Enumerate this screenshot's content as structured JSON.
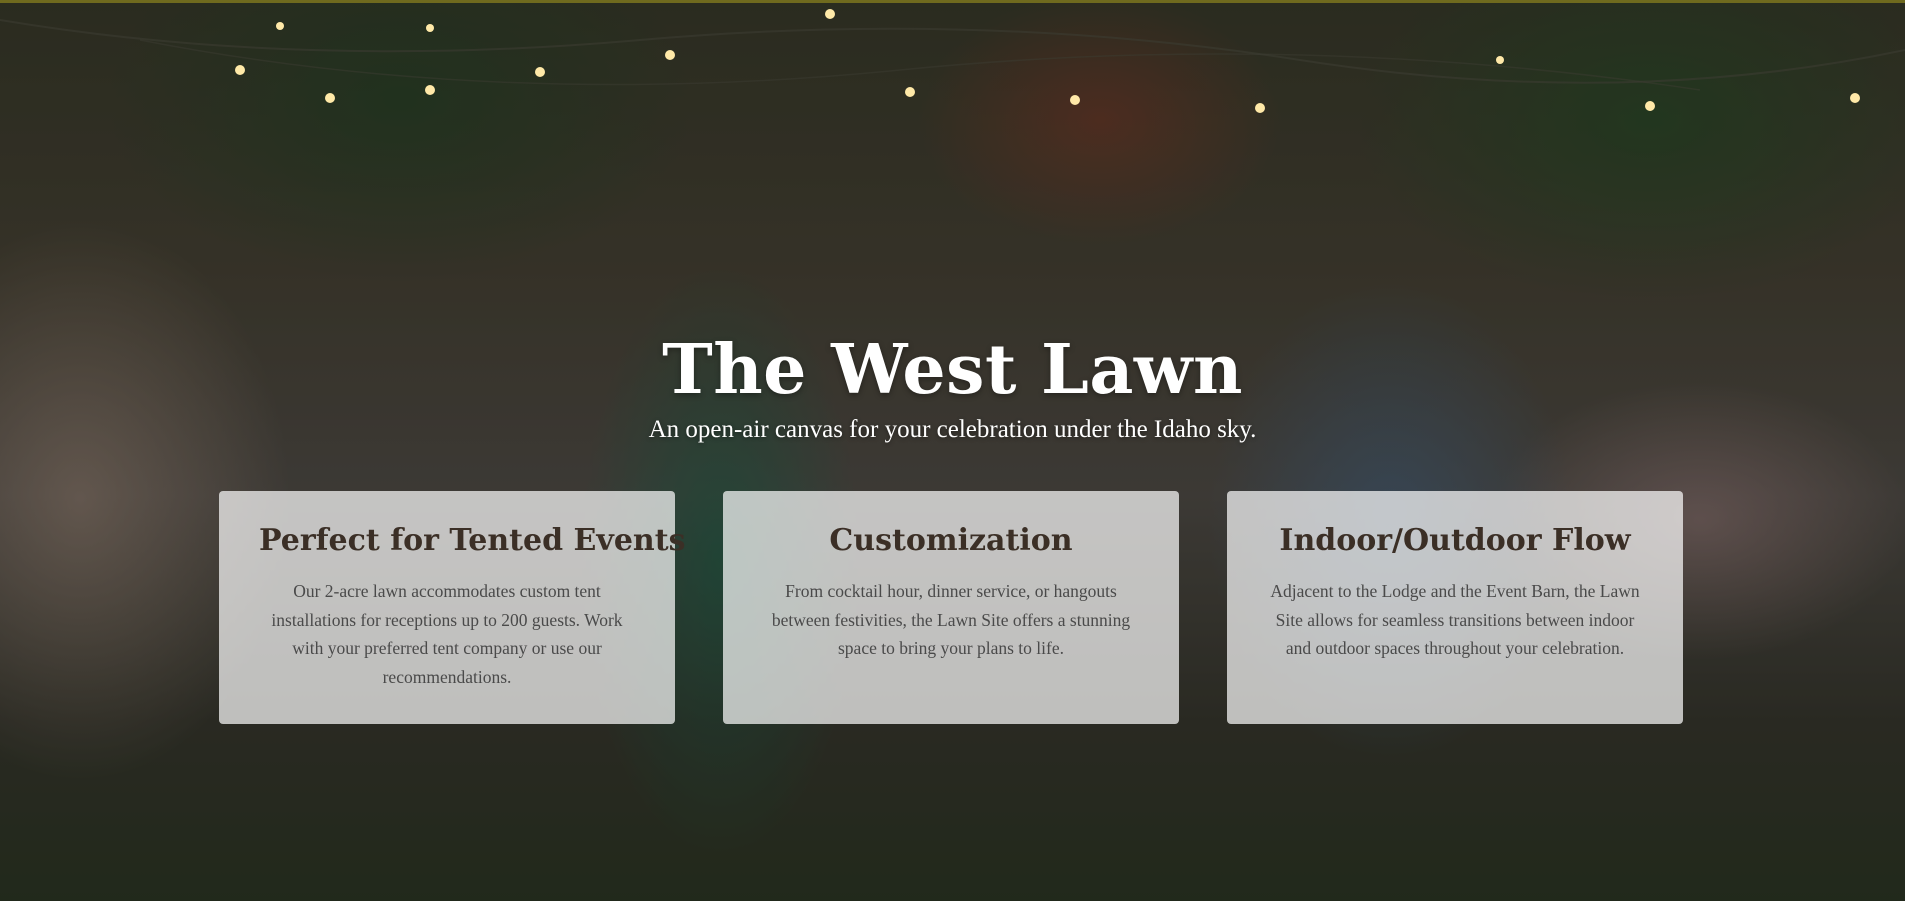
{
  "hero": {
    "title": "The West Lawn",
    "subtitle": "An open-air canvas for your celebration under the Idaho sky."
  },
  "features": [
    {
      "title": "Perfect for Tented Events",
      "text": "Our 2-acre lawn accommodates custom tent installations for receptions up to 200 guests. Work with your preferred tent company or use our recommendations."
    },
    {
      "title": "Customization",
      "text": "From cocktail hour, dinner service, or hangouts between festivities, the Lawn Site offers a stunning space to bring your plans to life."
    },
    {
      "title": "Indoor/Outdoor Flow",
      "text": "Adjacent to the Lodge and the Event Barn, the Lawn Site allows for seamless transitions between indoor and outdoor spaces throughout your celebration."
    }
  ],
  "colors": {
    "card_background": "#ffffff",
    "card_title": "#3b2f26",
    "card_text": "#4a4a4a",
    "hero_text": "#ffffff",
    "top_accent_line": "#6f6a1e"
  }
}
